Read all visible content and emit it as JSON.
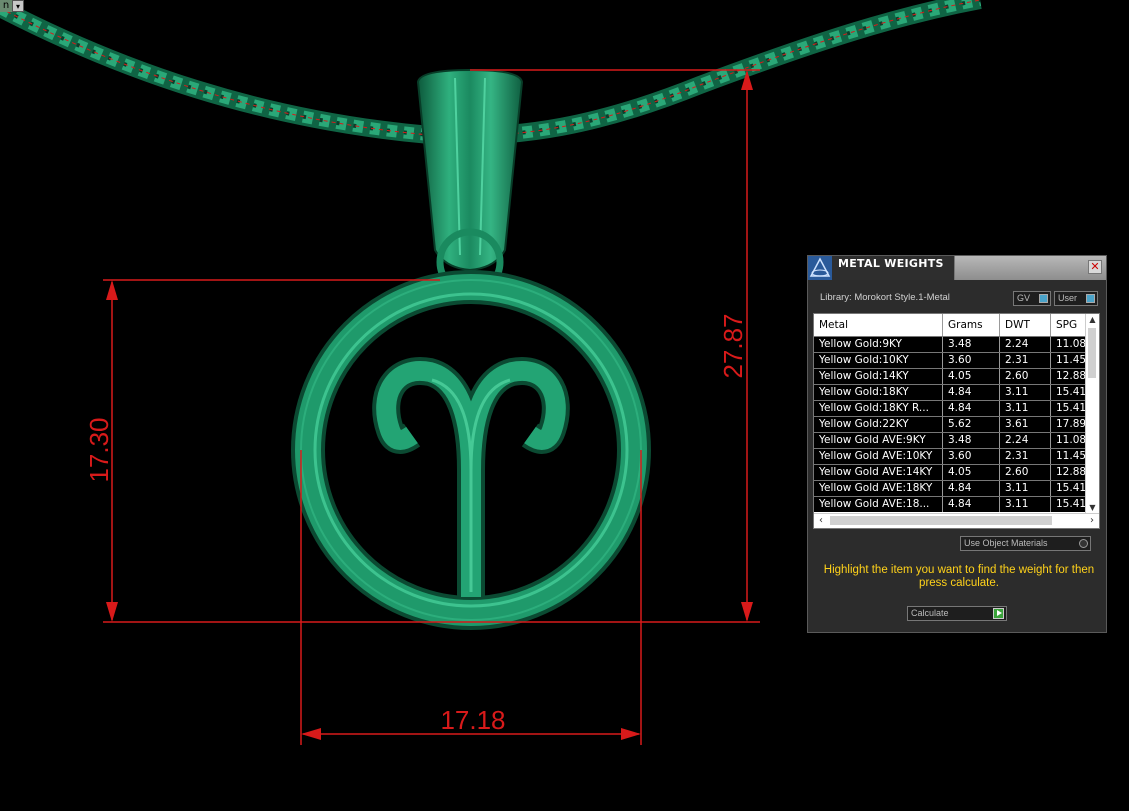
{
  "corner_widget": {
    "label": "n",
    "dropdown_glyph": "▾"
  },
  "dimensions": {
    "height_inner": "17.30",
    "height_total": "27.87",
    "width": "17.18"
  },
  "colors": {
    "model": "#1e8c63",
    "dimension": "#d81a1a",
    "hint_text": "#ffd21a"
  },
  "panel": {
    "title": "METAL WEIGHTS",
    "library": "Library: Morokort Style.1-Metal",
    "gv_label": "GV",
    "user_label": "User",
    "columns": [
      "Metal",
      "Grams",
      "DWT",
      "SPG"
    ],
    "rows": [
      [
        "Yellow Gold:9KY",
        "3.48",
        "2.24",
        "11.08"
      ],
      [
        "Yellow Gold:10KY",
        "3.60",
        "2.31",
        "11.45"
      ],
      [
        "Yellow Gold:14KY",
        "4.05",
        "2.60",
        "12.88"
      ],
      [
        "Yellow Gold:18KY",
        "4.84",
        "3.11",
        "15.41"
      ],
      [
        "Yellow Gold:18KY R...",
        "4.84",
        "3.11",
        "15.41"
      ],
      [
        "Yellow Gold:22KY",
        "5.62",
        "3.61",
        "17.89"
      ],
      [
        "Yellow Gold AVE:9KY",
        "3.48",
        "2.24",
        "11.08"
      ],
      [
        "Yellow Gold AVE:10KY",
        "3.60",
        "2.31",
        "11.45"
      ],
      [
        "Yellow Gold AVE:14KY",
        "4.05",
        "2.60",
        "12.88"
      ],
      [
        "Yellow Gold AVE:18KY",
        "4.84",
        "3.11",
        "15.41"
      ],
      [
        "Yellow Gold AVE:18...",
        "4.84",
        "3.11",
        "15.41"
      ]
    ],
    "use_object_materials": "Use Object Materials",
    "hint": "Highlight the item you want to find the weight for then press calculate.",
    "calculate": "Calculate"
  }
}
